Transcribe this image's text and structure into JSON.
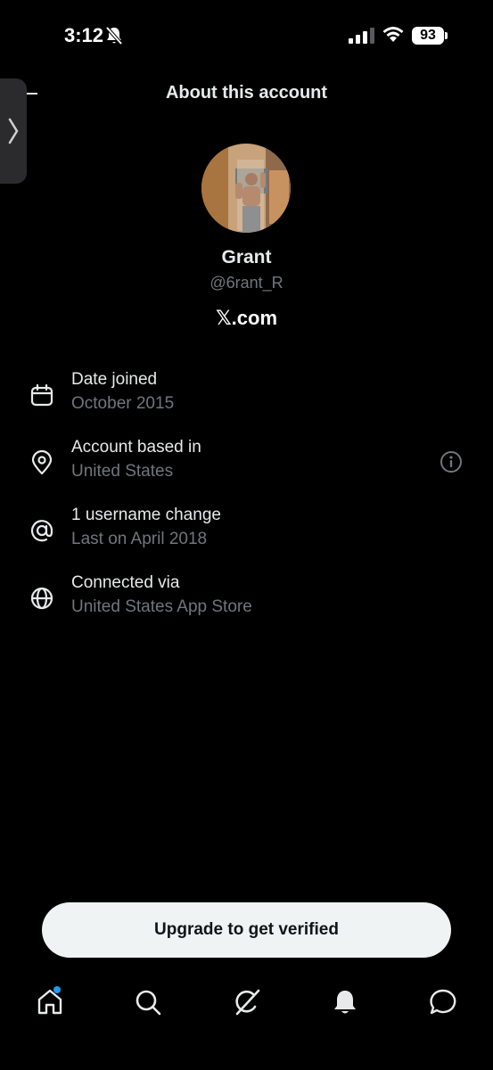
{
  "status_bar": {
    "time": "3:12",
    "battery": "93"
  },
  "header": {
    "title": "About this account"
  },
  "profile": {
    "name": "Grant",
    "handle": "@6rant_R",
    "site": "𝕏.com"
  },
  "info_rows": [
    {
      "icon": "calendar-icon",
      "title": "Date joined",
      "subtitle": "October 2015"
    },
    {
      "icon": "location-pin-icon",
      "title": "Account based in",
      "subtitle": "United States"
    },
    {
      "icon": "at-sign-icon",
      "title": "1 username change",
      "subtitle": "Last on April 2018"
    },
    {
      "icon": "globe-icon",
      "title": "Connected via",
      "subtitle": "United States App Store"
    }
  ],
  "upgrade_button": {
    "label": "Upgrade to get verified"
  },
  "tab_bar": {
    "items": [
      "home-icon",
      "search-icon",
      "grok-icon",
      "notifications-bell-icon",
      "messages-icon"
    ],
    "home_badge_color": "#1d9bf0"
  },
  "colors": {
    "background": "#000000",
    "primary_text": "#e7e9ea",
    "secondary_text": "#71767b",
    "button_background": "#eff3f4"
  }
}
